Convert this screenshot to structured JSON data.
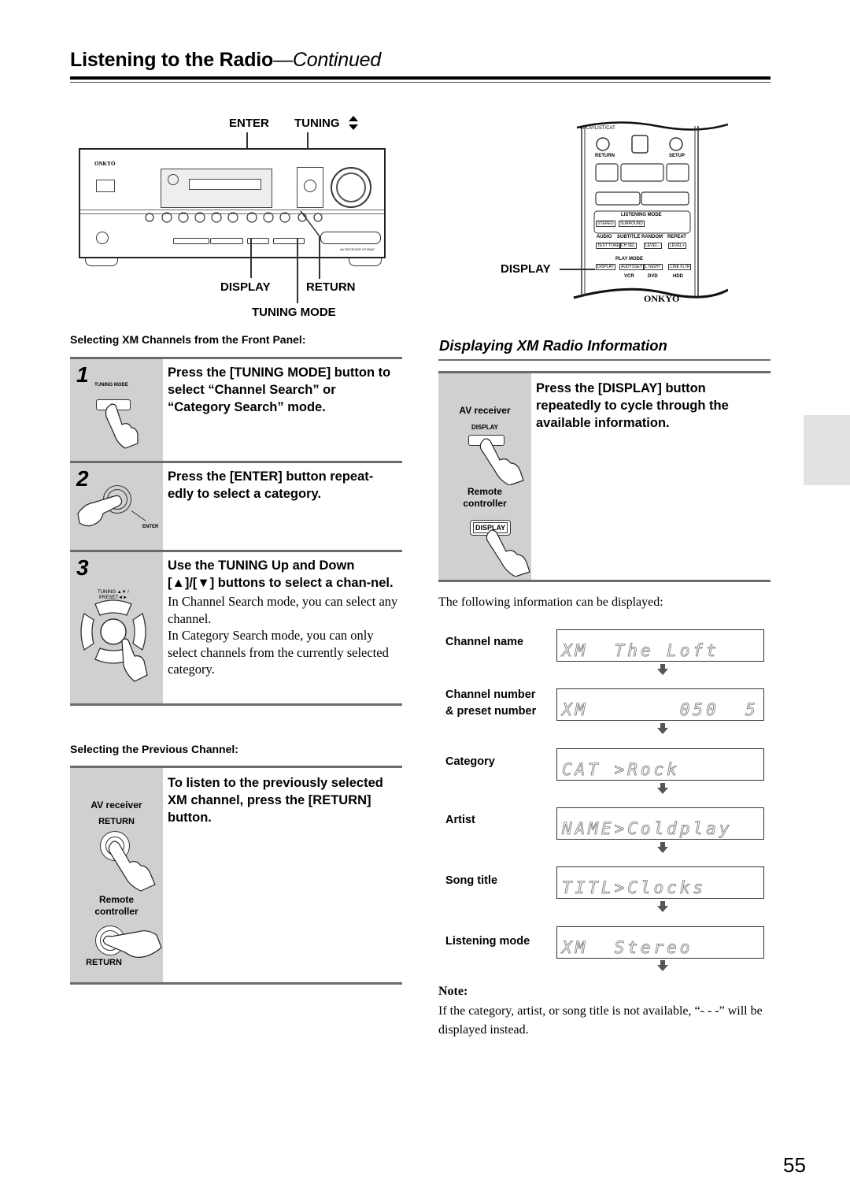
{
  "header": {
    "title": "Listening to the Radio",
    "title_suffix": "—Continued"
  },
  "receiver_diagram": {
    "labels": {
      "enter": "ENTER",
      "tuning": "TUNING",
      "tuning_arrows_icon": "up-down-arrows-icon",
      "display": "DISPLAY",
      "return": "RETURN",
      "tuning_mode": "TUNING MODE"
    },
    "brand": "ONKYO",
    "model": "AV RECEIVER HT-R640"
  },
  "remote_diagram": {
    "callout": "DISPLAY",
    "top_label": "◄PLAYLIST/CAT",
    "buttons": {
      "return": "RETURN",
      "setup": "SETUP",
      "listening_mode": "LISTENING MODE",
      "stereo": "STEREO",
      "surround": "SURROUND",
      "audio": "AUDIO",
      "subtitle": "SUBTITLE",
      "random": "RANDOM",
      "repeat": "REPEAT",
      "test_tone": "TEST TONE",
      "ch_sel": "CH SEL",
      "level_minus": "LEVEL−",
      "level_plus": "LEVEL+",
      "play_mode": "PLAY MODE",
      "display": "DISPLAY",
      "audyssey": "AUDYSSEY",
      "l_night": "L NIGHT",
      "cine_filter": "CINE FLTR",
      "vcr": "VCR",
      "dvd": "DVD",
      "hdd": "HDD"
    },
    "brand": "ONKYO"
  },
  "front_panel_section": {
    "heading": "Selecting XM Channels from the Front Panel:",
    "steps": [
      {
        "number": "1",
        "illustration_label": "TUNING MODE",
        "instruction": "Press the [TUNING MODE] button to select “Channel Search” or “Category Search” mode.",
        "body": []
      },
      {
        "number": "2",
        "illustration_label": "ENTER",
        "instruction": "Press the [ENTER] button repeat-edly to select a category.",
        "body": []
      },
      {
        "number": "3",
        "illustration_label": "TUNING ▲▼ / PRESET◄►",
        "instruction": "Use the TUNING Up and Down [▲]/[▼] buttons to select a chan-nel.",
        "body": [
          "In Channel Search mode, you can select any channel.",
          "In Category Search mode, you can only select channels from the currently selected category."
        ]
      }
    ]
  },
  "previous_channel_section": {
    "heading": "Selecting the Previous Channel:",
    "av_receiver_label": "AV receiver",
    "av_button_label": "RETURN",
    "remote_label_1": "Remote",
    "remote_label_2": "controller",
    "remote_button_label": "RETURN",
    "instruction": "To listen to the previously selected XM channel, press the [RETURN] button."
  },
  "xm_info_section": {
    "title": "Displaying XM Radio Information",
    "av_receiver_label": "AV receiver",
    "av_button_label": "DISPLAY",
    "remote_label_1": "Remote",
    "remote_label_2": "controller",
    "remote_button_label": "DISPLAY",
    "instruction": "Press the [DISPLAY] button repeatedly to cycle through the available information.",
    "intro": "The following information can be displayed:",
    "displays": [
      {
        "label": "Channel name",
        "label2": "",
        "lcd": "XM  The Loft"
      },
      {
        "label": "Channel number",
        "label2": "& preset number",
        "lcd": "XM       050  5"
      },
      {
        "label": "Category",
        "label2": "",
        "lcd": "CAT >Rock"
      },
      {
        "label": "Artist",
        "label2": "",
        "lcd": "NAME>Coldplay"
      },
      {
        "label": "Song title",
        "label2": "",
        "lcd": "TITL>Clocks"
      },
      {
        "label": "Listening mode",
        "label2": "",
        "lcd": "XM  Stereo"
      }
    ],
    "note_heading": "Note:",
    "note_text": "If the category, artist, or song title is not available, “- - -” will be displayed instead."
  },
  "page_number": "55"
}
